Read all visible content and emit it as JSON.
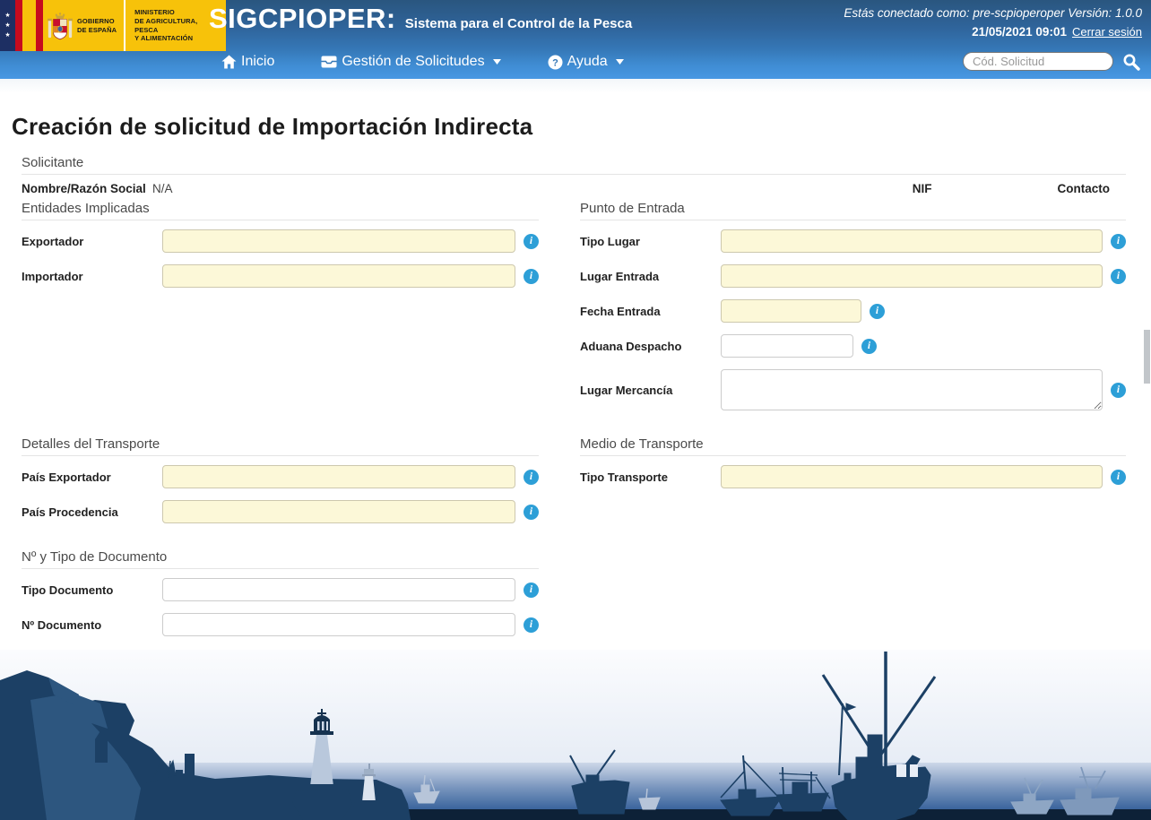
{
  "header": {
    "logo": {
      "gobierno_line1": "GOBIERNO",
      "gobierno_line2": "DE ESPAÑA",
      "ministerio_line1": "MINISTERIO",
      "ministerio_line2": "DE AGRICULTURA, PESCA",
      "ministerio_line3": "Y ALIMENTACIÓN"
    },
    "app_name": "SIGCPIOPER:",
    "app_subtitle": "Sistema para el Control de la Pesca",
    "session_text": "Estás conectado como: pre-scpioperoper Versión: 1.0.0",
    "datetime": "21/05/2021 09:01",
    "logout_label": "Cerrar sesión",
    "nav": {
      "inicio": "Inicio",
      "gestion": "Gestión de Solicitudes",
      "ayuda": "Ayuda"
    },
    "search": {
      "placeholder": "Cód. Solicitud",
      "value": ""
    }
  },
  "page": {
    "title": "Creación de solicitud de Importación Indirecta"
  },
  "form": {
    "solicitante": {
      "section": "Solicitante",
      "nombre_label": "Nombre/Razón Social",
      "nombre_value": "N/A",
      "nif_label": "NIF",
      "contacto_label": "Contacto"
    },
    "entidades": {
      "section": "Entidades Implicadas",
      "exportador_label": "Exportador",
      "exportador_value": "",
      "importador_label": "Importador",
      "importador_value": ""
    },
    "punto_entrada": {
      "section": "Punto de Entrada",
      "tipo_lugar_label": "Tipo Lugar",
      "tipo_lugar_value": "",
      "lugar_entrada_label": "Lugar Entrada",
      "lugar_entrada_value": "",
      "fecha_entrada_label": "Fecha Entrada",
      "fecha_entrada_value": "",
      "aduana_despacho_label": "Aduana Despacho",
      "aduana_despacho_value": "",
      "lugar_mercancia_label": "Lugar Mercancía",
      "lugar_mercancia_value": ""
    },
    "transporte": {
      "section": "Detalles del Transporte",
      "pais_exportador_label": "País Exportador",
      "pais_exportador_value": "",
      "pais_procedencia_label": "País Procedencia",
      "pais_procedencia_value": ""
    },
    "medio_transporte": {
      "section": "Medio de Transporte",
      "tipo_transporte_label": "Tipo Transporte",
      "tipo_transporte_value": ""
    },
    "documento": {
      "section": "Nº y Tipo de Documento",
      "tipo_documento_label": "Tipo Documento",
      "tipo_documento_value": "",
      "num_documento_label": "Nº Documento",
      "num_documento_value": ""
    }
  },
  "colors": {
    "accent_blue": "#2d9fd7",
    "field_yellow": "#fcf8d8",
    "header_top": "#2a567f",
    "header_bottom": "#4897e3",
    "logo_yellow": "#f7c20a",
    "flag_red": "#c60b1e",
    "navy_illustration": "#1c4065"
  }
}
